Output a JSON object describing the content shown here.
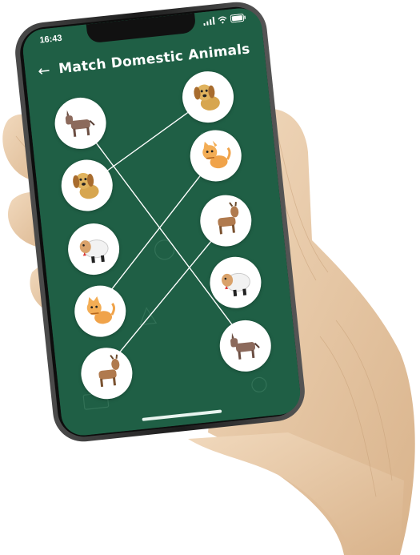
{
  "status_bar": {
    "time": "16:43"
  },
  "header": {
    "back_icon": "arrow-left-icon",
    "title": "Match Domestic Animals"
  },
  "left_column": [
    {
      "animal": "donkey",
      "icon": "donkey-icon"
    },
    {
      "animal": "dog",
      "icon": "dog-icon"
    },
    {
      "animal": "sheep",
      "icon": "sheep-icon"
    },
    {
      "animal": "cat",
      "icon": "cat-icon"
    },
    {
      "animal": "goat",
      "icon": "goat-icon"
    }
  ],
  "right_column": [
    {
      "animal": "dog",
      "icon": "dog-icon"
    },
    {
      "animal": "cat",
      "icon": "cat-icon"
    },
    {
      "animal": "goat",
      "icon": "goat-icon"
    },
    {
      "animal": "sheep",
      "icon": "sheep-icon"
    },
    {
      "animal": "donkey",
      "icon": "donkey-icon"
    }
  ],
  "connections": [
    {
      "from": "donkey",
      "to": "donkey"
    },
    {
      "from": "dog",
      "to": "dog"
    },
    {
      "from": "cat",
      "to": "cat"
    }
  ],
  "colors": {
    "board": "#1f5f45",
    "phone_frame": "#2a2a2a",
    "hand": "#e8c9a5"
  }
}
